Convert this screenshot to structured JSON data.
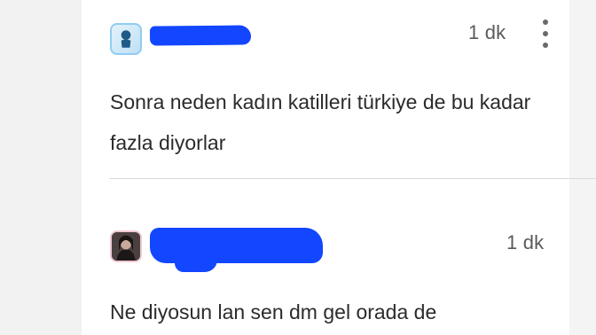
{
  "comments": [
    {
      "author_avatar": "default-user-avatar",
      "timestamp": "1 dk",
      "text": "Sonra neden kadın katilleri türkiye de bu kadar fazla diyorlar",
      "has_more_menu": true
    },
    {
      "author_avatar": "photo-avatar",
      "timestamp": "1 dk",
      "text": "Ne diyosun lan sen dm gel orada de",
      "has_more_menu": false
    }
  ],
  "colors": {
    "redaction": "#1246ff",
    "text": "#2b2b2b",
    "timestamp": "#5a5a5a",
    "divider": "#d9d9d9"
  }
}
